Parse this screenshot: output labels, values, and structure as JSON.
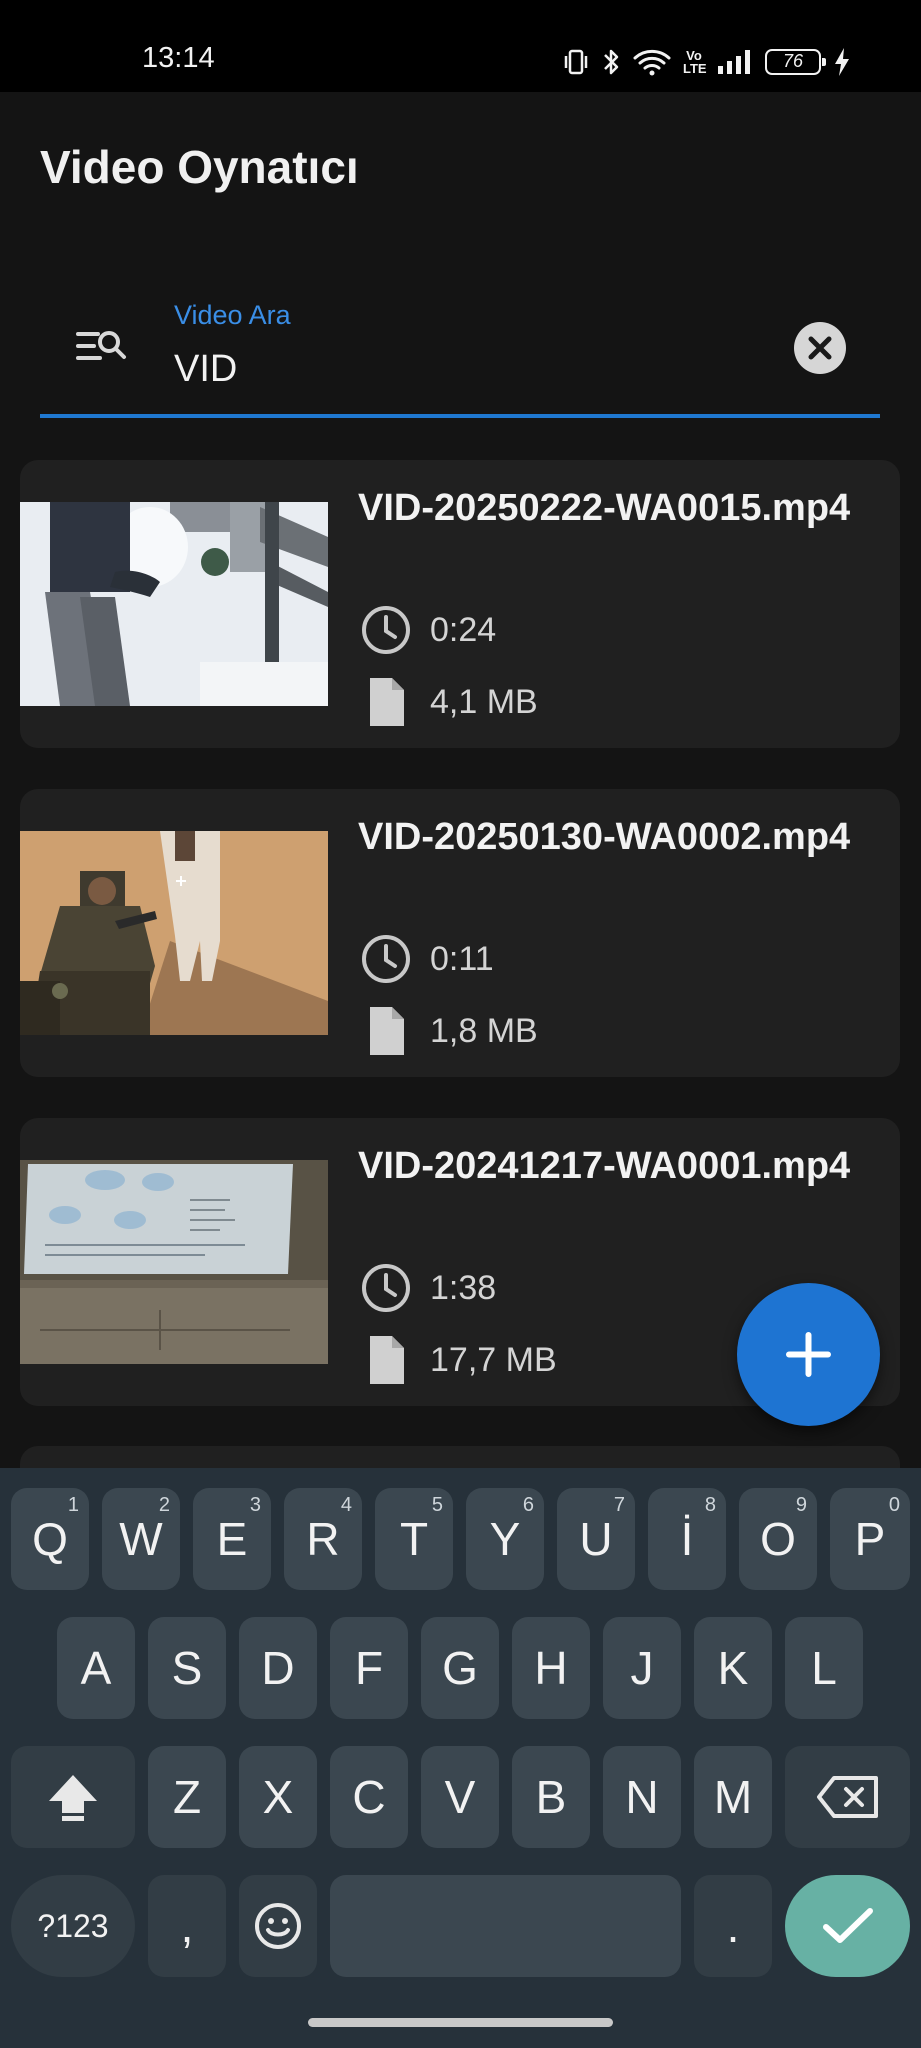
{
  "status_bar": {
    "time": "13:14",
    "network": "Vo LTE",
    "battery": "76"
  },
  "app": {
    "title": "Video Oynatıcı"
  },
  "search": {
    "label": "Video Ara",
    "value": "VID"
  },
  "videos": [
    {
      "name": "VID-20250222-WA0015.mp4",
      "duration": "0:24",
      "size": "4,1 MB"
    },
    {
      "name": "VID-20250130-WA0002.mp4",
      "duration": "0:11",
      "size": "1,8 MB"
    },
    {
      "name": "VID-20241217-WA0001.mp4",
      "duration": "1:38",
      "size": "17,7 MB"
    }
  ],
  "fab": {
    "icon": "plus-icon"
  },
  "keyboard": {
    "row1": [
      {
        "key": "Q",
        "hint": "1"
      },
      {
        "key": "W",
        "hint": "2"
      },
      {
        "key": "E",
        "hint": "3"
      },
      {
        "key": "R",
        "hint": "4"
      },
      {
        "key": "T",
        "hint": "5"
      },
      {
        "key": "Y",
        "hint": "6"
      },
      {
        "key": "U",
        "hint": "7"
      },
      {
        "key": "İ",
        "hint": "8"
      },
      {
        "key": "O",
        "hint": "9"
      },
      {
        "key": "P",
        "hint": "0"
      }
    ],
    "row2": [
      "A",
      "S",
      "D",
      "F",
      "G",
      "H",
      "J",
      "K",
      "L"
    ],
    "row3": [
      "Z",
      "X",
      "C",
      "V",
      "B",
      "N",
      "M"
    ],
    "symbols": "?123",
    "comma": ",",
    "period": "."
  },
  "colors": {
    "accent": "#1f78d1",
    "fab": "#1e74d2",
    "enter": "#67b1a4",
    "background": "#141414",
    "card": "#202020"
  }
}
